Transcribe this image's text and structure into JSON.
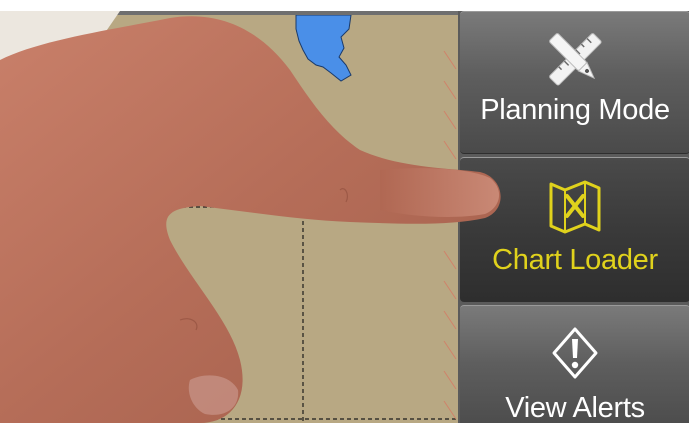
{
  "menu": {
    "items": [
      {
        "label": "Planning Mode",
        "icon": "planning-tools-icon",
        "active": false
      },
      {
        "label": "Chart Loader",
        "icon": "chart-loader-icon",
        "active": true
      },
      {
        "label": "View Alerts",
        "icon": "alert-icon",
        "active": false
      }
    ]
  },
  "colors": {
    "chart_land": "#b8a883",
    "water": "#4a8fe8",
    "active_label": "#e0d21c",
    "menu_bg": "#5b5b5b"
  }
}
